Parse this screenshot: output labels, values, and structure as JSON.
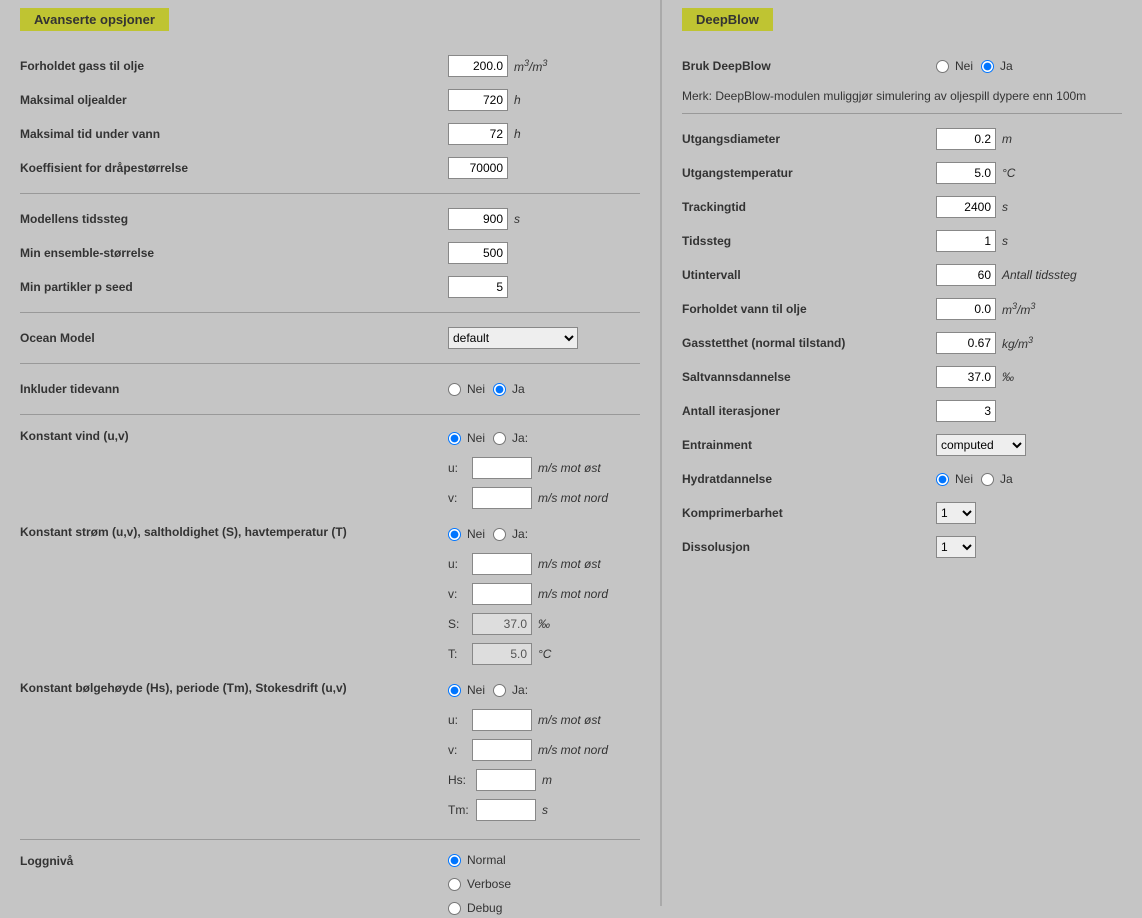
{
  "left": {
    "title": "Avanserte opsjoner",
    "gas_oil_ratio": {
      "label": "Forholdet gass til olje",
      "value": "200.0",
      "unit": "m³/m³"
    },
    "max_oil_age": {
      "label": "Maksimal oljealder",
      "value": "720",
      "unit": "h"
    },
    "max_time_underwater": {
      "label": "Maksimal tid under vann",
      "value": "72",
      "unit": "h"
    },
    "drop_coeff": {
      "label": "Koeffisient for dråpestørrelse",
      "value": "70000",
      "unit": ""
    },
    "model_timestep": {
      "label": "Modellens tidssteg",
      "value": "900",
      "unit": "s"
    },
    "min_ensemble": {
      "label": "Min ensemble-størrelse",
      "value": "500",
      "unit": ""
    },
    "min_particles": {
      "label": "Min partikler p seed",
      "value": "5",
      "unit": ""
    },
    "ocean_model": {
      "label": "Ocean Model",
      "value": "default"
    },
    "include_tide": {
      "label": "Inkluder tidevann",
      "nei": "Nei",
      "ja": "Ja",
      "selected": "ja"
    },
    "const_wind": {
      "label": "Konstant vind (u,v)",
      "nei": "Nei",
      "ja": "Ja:",
      "selected": "nei",
      "u_lbl": "u:",
      "u_val": "",
      "u_unit": "m/s mot øst",
      "v_lbl": "v:",
      "v_val": "",
      "v_unit": "m/s mot nord"
    },
    "const_current": {
      "label": "Konstant strøm (u,v), saltholdighet (S), havtemperatur (T)",
      "nei": "Nei",
      "ja": "Ja:",
      "selected": "nei",
      "u_lbl": "u:",
      "u_val": "",
      "u_unit": "m/s mot øst",
      "v_lbl": "v:",
      "v_val": "",
      "v_unit": "m/s mot nord",
      "s_lbl": "S:",
      "s_val": "37.0",
      "s_unit": "‰",
      "t_lbl": "T:",
      "t_val": "5.0",
      "t_unit": "°C"
    },
    "const_wave": {
      "label": "Konstant bølgehøyde (Hs), periode (Tm), Stokesdrift (u,v)",
      "nei": "Nei",
      "ja": "Ja:",
      "selected": "nei",
      "u_lbl": "u:",
      "u_val": "",
      "u_unit": "m/s mot øst",
      "v_lbl": "v:",
      "v_val": "",
      "v_unit": "m/s mot nord",
      "hs_lbl": "Hs:",
      "hs_val": "",
      "hs_unit": "m",
      "tm_lbl": "Tm:",
      "tm_val": "",
      "tm_unit": "s"
    },
    "loglevel": {
      "label": "Loggnivå",
      "options": {
        "normal": "Normal",
        "verbose": "Verbose",
        "debug": "Debug"
      },
      "selected": "normal"
    }
  },
  "right": {
    "title": "DeepBlow",
    "use_deepblow": {
      "label": "Bruk DeepBlow",
      "nei": "Nei",
      "ja": "Ja",
      "selected": "ja"
    },
    "note": "Merk: DeepBlow-modulen muliggjør simulering av oljespill dypere enn 100m",
    "exit_diameter": {
      "label": "Utgangsdiameter",
      "value": "0.2",
      "unit": "m"
    },
    "exit_temp": {
      "label": "Utgangstemperatur",
      "value": "5.0",
      "unit": "°C"
    },
    "tracking_time": {
      "label": "Trackingtid",
      "value": "2400",
      "unit": "s"
    },
    "timestep": {
      "label": "Tidssteg",
      "value": "1",
      "unit": "s"
    },
    "out_interval": {
      "label": "Utintervall",
      "value": "60",
      "unit": "Antall tidssteg"
    },
    "water_oil_ratio": {
      "label": "Forholdet vann til olje",
      "value": "0.0",
      "unit": "m³/m³"
    },
    "gas_density": {
      "label": "Gasstetthet (normal tilstand)",
      "value": "0.67",
      "unit": "kg/m³"
    },
    "salt_formation": {
      "label": "Saltvannsdannelse",
      "value": "37.0",
      "unit": "‰"
    },
    "iterations": {
      "label": "Antall iterasjoner",
      "value": "3",
      "unit": ""
    },
    "entrainment": {
      "label": "Entrainment",
      "value": "computed"
    },
    "hydrate": {
      "label": "Hydratdannelse",
      "nei": "Nei",
      "ja": "Ja",
      "selected": "nei"
    },
    "compressibility": {
      "label": "Komprimerbarhet",
      "value": "1"
    },
    "dissolution": {
      "label": "Dissolusjon",
      "value": "1"
    }
  }
}
